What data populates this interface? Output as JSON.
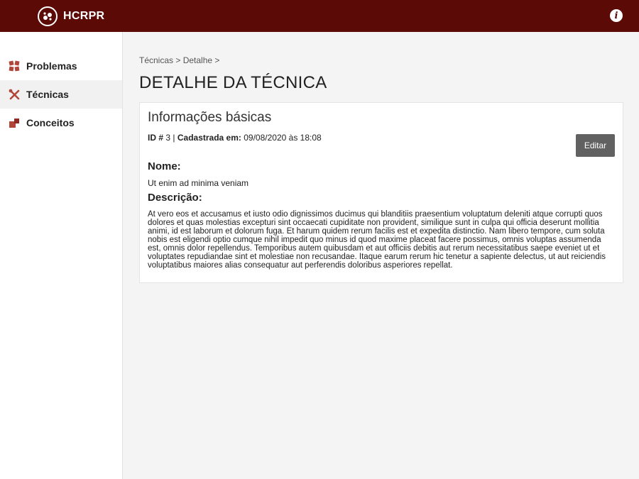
{
  "app": {
    "name": "HCRPR",
    "info_icon": "i",
    "brand_color": "#5c0a05",
    "accent_color": "#b2453a"
  },
  "sidebar": {
    "items": [
      {
        "label": "Problemas",
        "icon": "puzzle-icon",
        "active": false
      },
      {
        "label": "Técnicas",
        "icon": "tools-icon",
        "active": true
      },
      {
        "label": "Conceitos",
        "icon": "blocks-icon",
        "active": false
      }
    ]
  },
  "breadcrumb": "Técnicas > Detalhe >",
  "page_title": "DETALHE DA TÉCNICA",
  "card": {
    "title": "Informações básicas",
    "id_label": "ID #",
    "id_value": "3",
    "separator": "|",
    "registered_label": "Cadastrada em:",
    "registered_value": "09/08/2020 às 18:08",
    "edit_label": "Editar",
    "nome_label": "Nome:",
    "nome_value": "Ut enim ad minima veniam",
    "descricao_label": "Descrição:",
    "descricao_value": "At vero eos et accusamus et iusto odio dignissimos ducimus qui blanditiis praesentium voluptatum deleniti atque corrupti quos dolores et quas molestias excepturi sint occaecati cupiditate non provident, similique sunt in culpa qui officia deserunt mollitia animi, id est laborum et dolorum fuga. Et harum quidem rerum facilis est et expedita distinctio. Nam libero tempore, cum soluta nobis est eligendi optio cumque nihil impedit quo minus id quod maxime placeat facere possimus, omnis voluptas assumenda est, omnis dolor repellendus. Temporibus autem quibusdam et aut officiis debitis aut rerum necessitatibus saepe eveniet ut et voluptates repudiandae sint et molestiae non recusandae. Itaque earum rerum hic tenetur a sapiente delectus, ut aut reiciendis voluptatibus maiores alias consequatur aut perferendis doloribus asperiores repellat."
  }
}
